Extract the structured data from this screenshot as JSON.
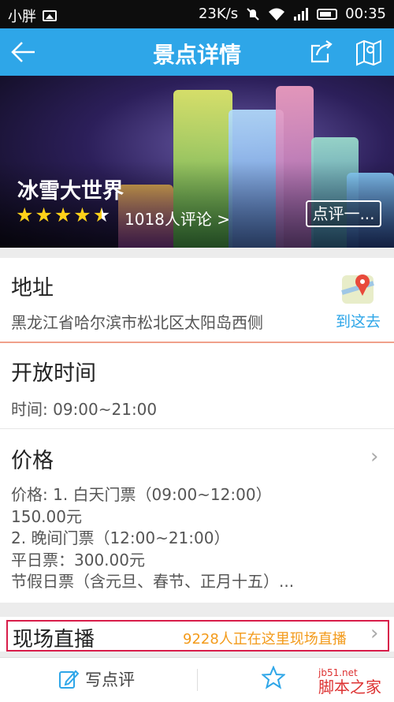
{
  "status": {
    "carrier": "小胖",
    "speed": "23K/s",
    "time": "00:35"
  },
  "nav": {
    "title": "景点详情"
  },
  "hero": {
    "name": "冰雪大世界",
    "rating": 4.5,
    "reviews": "1018人评论 >",
    "review_button": "点评一..."
  },
  "address": {
    "title": "地址",
    "text": "黑龙江省哈尔滨市松北区太阳岛西侧",
    "goto": "到这去"
  },
  "hours": {
    "title": "开放时间",
    "text": "时间: 09:00~21:00"
  },
  "price": {
    "title": "价格",
    "lines": [
      "价格: 1. 白天门票（09:00~12:00）",
      "150.00元",
      "2. 晚间门票（12:00~21:00）",
      "平日票：300.00元",
      "节假日票（含元旦、春节、正月十五）..."
    ]
  },
  "live": {
    "title": "现场直播",
    "count": "9228人正在这里现场直播"
  },
  "bottom": {
    "write_review": "写点评"
  },
  "watermark": {
    "site": "jb51.net",
    "name": "脚本之家"
  },
  "colors": {
    "accent": "#2ea6e8",
    "star": "#ffd21a",
    "live_text": "#f39a1a",
    "highlight_box": "#d81d4a"
  }
}
